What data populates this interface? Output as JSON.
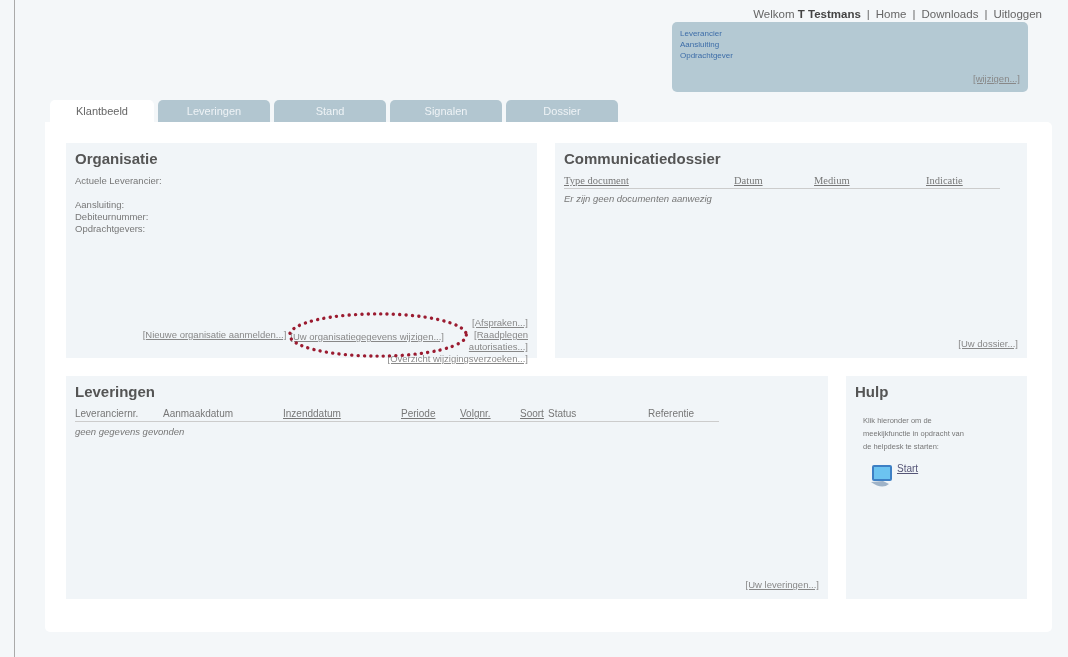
{
  "header": {
    "items": [
      {
        "kind": "welcome",
        "text": "Welkom **T Testmans**"
      },
      {
        "kind": "separator",
        "text": "|"
      },
      {
        "kind": "link",
        "text": "Home"
      },
      {
        "kind": "separator",
        "text": "|"
      },
      {
        "kind": "link",
        "text": "Downloads"
      },
      {
        "kind": "separator",
        "text": "|"
      },
      {
        "kind": "link",
        "text": "Uitloggen"
      }
    ]
  },
  "context_box": {
    "links": [
      "Leverancier",
      "Aansluiting",
      "Opdrachtgever"
    ],
    "action": "[wijzigen...]"
  },
  "tabs": [
    {
      "label": "Klantbeeld",
      "selected": true
    },
    {
      "label": "Leveringen",
      "selected": false
    },
    {
      "label": "Stand",
      "selected": false
    },
    {
      "label": "Signalen",
      "selected": false
    },
    {
      "label": "Dossier",
      "selected": false
    }
  ],
  "organisatie": {
    "title": "Organisatie",
    "field_groups": [
      [
        "Actuele Leverancier:"
      ],
      [
        "Aansluiting:",
        "Debiteurnummer:",
        "Opdrachtgevers:"
      ]
    ],
    "link_rows": [
      [
        {
          "text": "[Afspraken...]",
          "highlighted": false
        }
      ],
      [
        {
          "text": "[Nieuwe organisatie aanmelden...]",
          "highlighted": false
        },
        {
          "text": "[Uw organisatiegegevens wijzigen...]",
          "highlighted": true
        },
        {
          "text": "[Raadplegen autorisaties...]",
          "highlighted": false
        }
      ],
      [
        {
          "text": "[Overzicht wijzigingsverzoeken...]",
          "highlighted": false
        }
      ]
    ]
  },
  "communicatiedossier": {
    "title": "Communicatiedossier",
    "columns": [
      {
        "label": "Type document",
        "sortable": true
      },
      {
        "label": "Datum",
        "sortable": true
      },
      {
        "label": "Medium",
        "sortable": true
      },
      {
        "label": "Indicatie",
        "sortable": true
      }
    ],
    "empty_text": "Er zijn geen documenten aanwezig",
    "footer_link": "[Uw dossier...]"
  },
  "leveringen": {
    "title": "Leveringen",
    "columns": [
      {
        "label": "Leveranciernr.",
        "sortable": false
      },
      {
        "label": "Aanmaakdatum",
        "sortable": false
      },
      {
        "label": "Inzenddatum",
        "sortable": true
      },
      {
        "label": "Periode",
        "sortable": true
      },
      {
        "label": "Volgnr.",
        "sortable": true
      },
      {
        "label": "Soort",
        "sortable": true
      },
      {
        "label": "Status",
        "sortable": false
      },
      {
        "label": "Referentie",
        "sortable": false
      }
    ],
    "empty_text": "geen gegevens gevonden",
    "footer_link": "[Uw leveringen...]"
  },
  "hulp": {
    "title": "Hulp",
    "text": "Klik hieronder om de meekijkfunctie in opdracht van de helpdesk te starten:",
    "start_link": "Start"
  }
}
